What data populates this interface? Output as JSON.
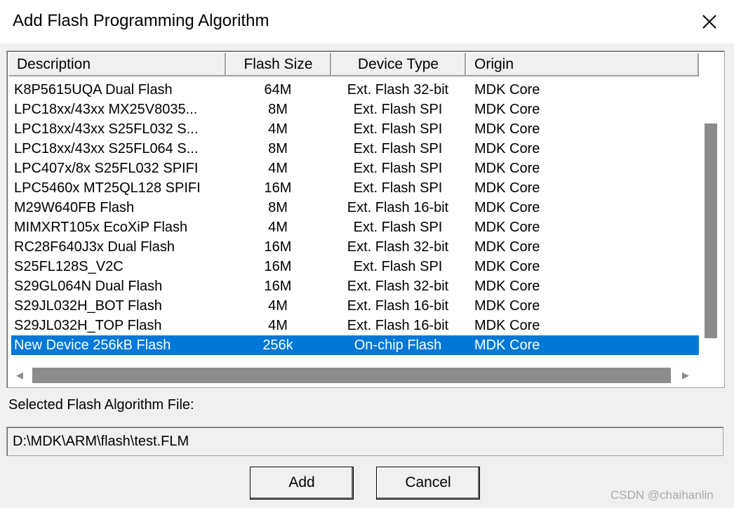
{
  "window": {
    "title": "Add Flash Programming Algorithm",
    "close_icon": "close-icon"
  },
  "table": {
    "columns": [
      "Description",
      "Flash Size",
      "Device Type",
      "Origin"
    ],
    "rows": [
      {
        "description": "K8P5615UQA Dual Flash",
        "size": "64M",
        "type": "Ext. Flash 32-bit",
        "origin": "MDK Core"
      },
      {
        "description": "LPC18xx/43xx MX25V8035...",
        "size": "8M",
        "type": "Ext. Flash SPI",
        "origin": "MDK Core"
      },
      {
        "description": "LPC18xx/43xx S25FL032 S...",
        "size": "4M",
        "type": "Ext. Flash SPI",
        "origin": "MDK Core"
      },
      {
        "description": "LPC18xx/43xx S25FL064 S...",
        "size": "8M",
        "type": "Ext. Flash SPI",
        "origin": "MDK Core"
      },
      {
        "description": "LPC407x/8x S25FL032 SPIFI",
        "size": "4M",
        "type": "Ext. Flash SPI",
        "origin": "MDK Core"
      },
      {
        "description": "LPC5460x MT25QL128 SPIFI",
        "size": "16M",
        "type": "Ext. Flash SPI",
        "origin": "MDK Core"
      },
      {
        "description": "M29W640FB Flash",
        "size": "8M",
        "type": "Ext. Flash 16-bit",
        "origin": "MDK Core"
      },
      {
        "description": "MIMXRT105x EcoXiP Flash",
        "size": "4M",
        "type": "Ext. Flash SPI",
        "origin": "MDK Core"
      },
      {
        "description": "RC28F640J3x Dual Flash",
        "size": "16M",
        "type": "Ext. Flash 32-bit",
        "origin": "MDK Core"
      },
      {
        "description": "S25FL128S_V2C",
        "size": "16M",
        "type": "Ext. Flash SPI",
        "origin": "MDK Core"
      },
      {
        "description": "S29GL064N Dual Flash",
        "size": "16M",
        "type": "Ext. Flash 32-bit",
        "origin": "MDK Core"
      },
      {
        "description": "S29JL032H_BOT Flash",
        "size": "4M",
        "type": "Ext. Flash 16-bit",
        "origin": "MDK Core"
      },
      {
        "description": "S29JL032H_TOP Flash",
        "size": "4M",
        "type": "Ext. Flash 16-bit",
        "origin": "MDK Core"
      },
      {
        "description": "New Device 256kB Flash",
        "size": "256k",
        "type": "On-chip Flash",
        "origin": "MDK Core"
      }
    ],
    "selected_index": 13
  },
  "file": {
    "label": "Selected Flash Algorithm File:",
    "value": "D:\\MDK\\ARM\\flash\\test.FLM"
  },
  "buttons": {
    "add": "Add",
    "cancel": "Cancel"
  },
  "watermark": "CSDN @chaihanlin",
  "colors": {
    "selection": "#0078d7",
    "background": "#f0f0f0",
    "scroll_thumb": "#8c8c8c"
  }
}
